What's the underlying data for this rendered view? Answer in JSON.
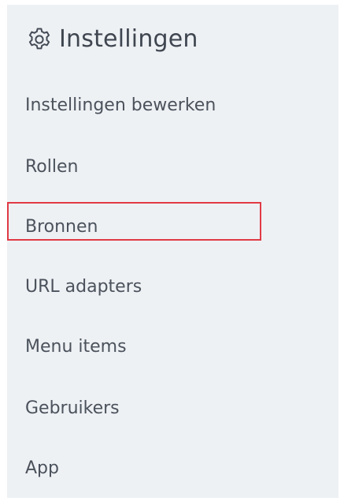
{
  "header": {
    "icon": "gear-icon",
    "title": "Instellingen"
  },
  "menu": {
    "items": [
      {
        "label": "Instellingen bewerken"
      },
      {
        "label": "Rollen"
      },
      {
        "label": "Bronnen"
      },
      {
        "label": "URL adapters"
      },
      {
        "label": "Menu items"
      },
      {
        "label": "Gebruikers"
      },
      {
        "label": "App"
      }
    ],
    "selected": "Bronnen",
    "highlight_color": "#e03a44"
  }
}
